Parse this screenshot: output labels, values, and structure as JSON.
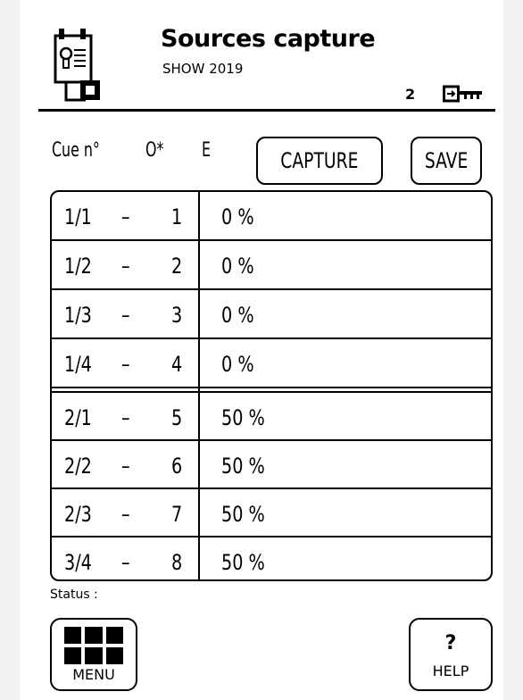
{
  "header": {
    "title": "Sources capture",
    "subtitle": "SHOW 2019",
    "user_count": "2",
    "app_icon": "clipboard-icon",
    "key_icon": "key-icon"
  },
  "controls": {
    "cue_label": "Cue n°",
    "o_label": "O*",
    "e_label": "E",
    "capture_label": "CAPTURE",
    "save_label": "SAVE"
  },
  "table": {
    "rows": [
      {
        "cue": "1/1",
        "dash": "–",
        "num": "1",
        "value": "0 %"
      },
      {
        "cue": "1/2",
        "dash": "–",
        "num": "2",
        "value": "0 %"
      },
      {
        "cue": "1/3",
        "dash": "–",
        "num": "3",
        "value": "0 %"
      },
      {
        "cue": "1/4",
        "dash": "–",
        "num": "4",
        "value": "0 %"
      },
      {
        "cue": "2/1",
        "dash": "–",
        "num": "5",
        "value": "50 %"
      },
      {
        "cue": "2/2",
        "dash": "–",
        "num": "6",
        "value": "50 %"
      },
      {
        "cue": "2/3",
        "dash": "–",
        "num": "7",
        "value": "50 %"
      },
      {
        "cue": "3/4",
        "dash": "–",
        "num": "8",
        "value": "50 %"
      }
    ]
  },
  "status": {
    "label": "Status :"
  },
  "footer": {
    "menu_label": "MENU",
    "help_symbol": "?",
    "help_label": "HELP",
    "menu_icon": "grid-menu-icon"
  }
}
